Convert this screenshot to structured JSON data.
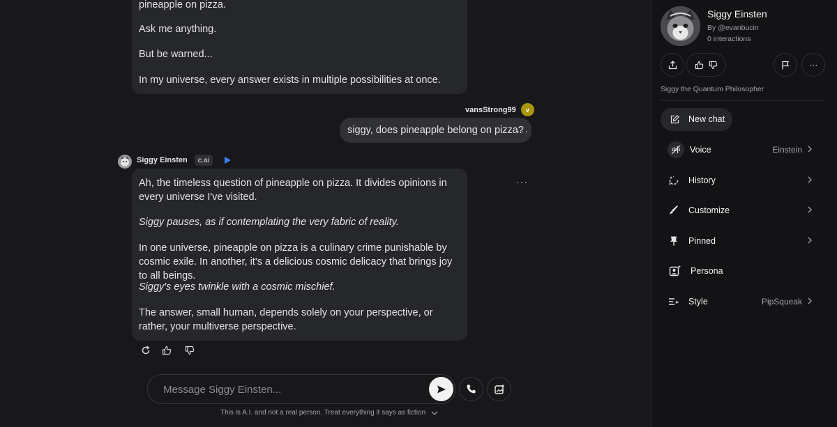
{
  "chat": {
    "first_message": [
      {
        "text": "pineapple on pizza.",
        "italic": false
      },
      {
        "text": "Ask me anything.",
        "italic": false
      },
      {
        "text": "But be warned...",
        "italic": false
      },
      {
        "text": "In my universe, every answer exists in multiple possibilities at once.",
        "italic": false
      }
    ],
    "user": {
      "name": "vansStrong99",
      "avatar_letter": "v",
      "message": "siggy, does pineapple belong on pizza?"
    },
    "bot": {
      "name": "Siggy Einsten",
      "tag": "c.ai",
      "paragraphs": [
        {
          "text": "Ah, the timeless question of pineapple on pizza. It divides opinions in every universe I've visited.",
          "italic": false
        },
        {
          "text": "Siggy pauses, as if contemplating the very fabric of reality.",
          "italic": true
        },
        {
          "text": "In one universe, pineapple on pizza is a culinary crime punishable by cosmic exile. In another, it's a delicious cosmic delicacy that brings joy to all beings.",
          "italic": false
        },
        {
          "text": "Siggy's eyes twinkle with a cosmic mischief.",
          "italic": true
        },
        {
          "text": "The answer, small human, depends solely on your perspective, or rather, your multiverse perspective.",
          "italic": false
        }
      ]
    },
    "message_actions": [
      "refresh-icon",
      "thumbs-up-icon",
      "thumbs-down-icon"
    ],
    "more_label": "···"
  },
  "composer": {
    "placeholder": "Message Siggy Einsten...",
    "disclaimer": "This is A.I. and not a real person. Treat everything it says as fiction"
  },
  "sidebar": {
    "character_name": "Siggy Einsten",
    "by": "By @evanbucin",
    "interactions": "0 interactions",
    "description": "Siggy the Quantum Philosopher",
    "new_chat": "New chat",
    "menu": [
      {
        "key": "voice",
        "label": "Voice",
        "value": "Einstein",
        "chevron": true,
        "icon": "voice-icon"
      },
      {
        "key": "history",
        "label": "History",
        "value": "",
        "chevron": true,
        "icon": "history-icon"
      },
      {
        "key": "customize",
        "label": "Customize",
        "value": "",
        "chevron": true,
        "icon": "brush-icon"
      },
      {
        "key": "pinned",
        "label": "Pinned",
        "value": "",
        "chevron": true,
        "icon": "pin-icon"
      },
      {
        "key": "persona",
        "label": "Persona",
        "value": "",
        "chevron": false,
        "icon": "persona-icon"
      },
      {
        "key": "style",
        "label": "Style",
        "value": "PipSqueak",
        "chevron": true,
        "icon": "style-icon"
      }
    ]
  },
  "colors": {
    "background": "#18181b",
    "sidebar": "#131316",
    "bubble": "#26272b",
    "accent_play": "#3b82f6",
    "user_avatar": "#a8960f"
  }
}
